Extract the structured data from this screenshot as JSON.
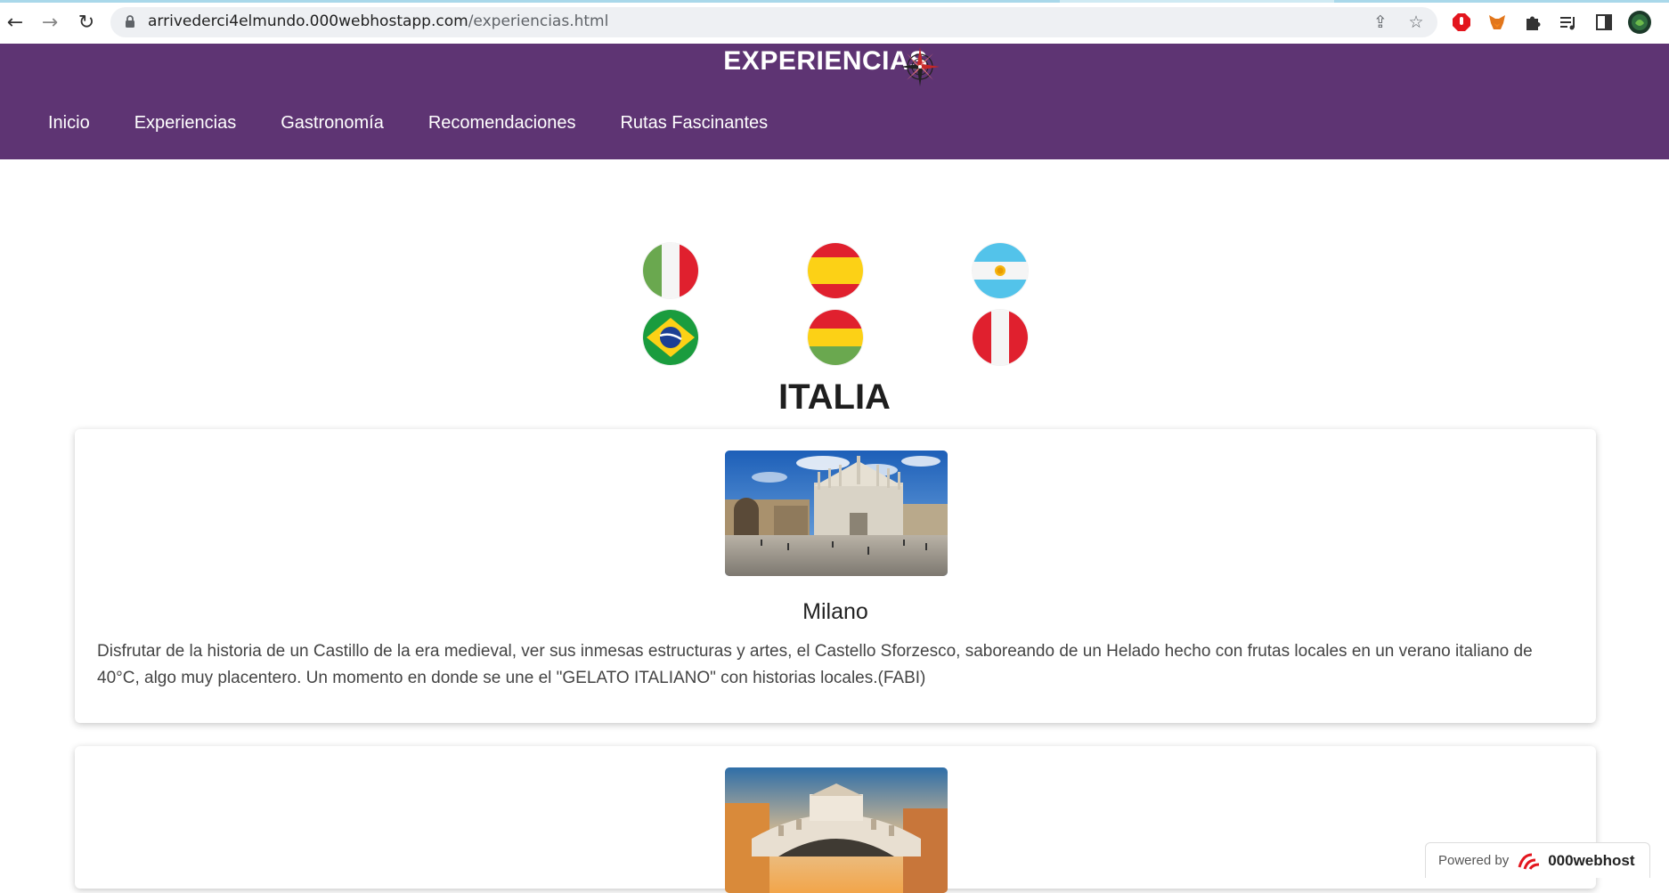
{
  "browser": {
    "url_host": "arrivederci4elmundo.000webhostapp.com",
    "url_path": "/experiencias.html"
  },
  "site": {
    "title": "EXPERIENCIAS",
    "nav": [
      "Inicio",
      "Experiencias",
      "Gastronomía",
      "Recomendaciones",
      "Rutas Fascinantes"
    ]
  },
  "flags": [
    "italy",
    "spain",
    "argentina",
    "brazil",
    "bolivia",
    "peru"
  ],
  "section": {
    "country": "ITALIA",
    "cards": [
      {
        "title": "Milano",
        "text": "Disfrutar de la historia de un Castillo de la era medieval, ver sus inmesas estructuras y artes, el Castello Sforzesco, saboreando de un Helado hecho con frutas locales en un verano italiano de 40°C, algo muy placentero. Un momento en donde se une el \"GELATO ITALIANO\" con historias locales.(FABI)"
      },
      {
        "title": "",
        "text": ""
      }
    ]
  },
  "footer_badge": {
    "powered_by": "Powered by",
    "brand": "000webhost"
  },
  "colors": {
    "header_bg": "#5e3473",
    "omnibox_bg": "#eef0f3"
  }
}
